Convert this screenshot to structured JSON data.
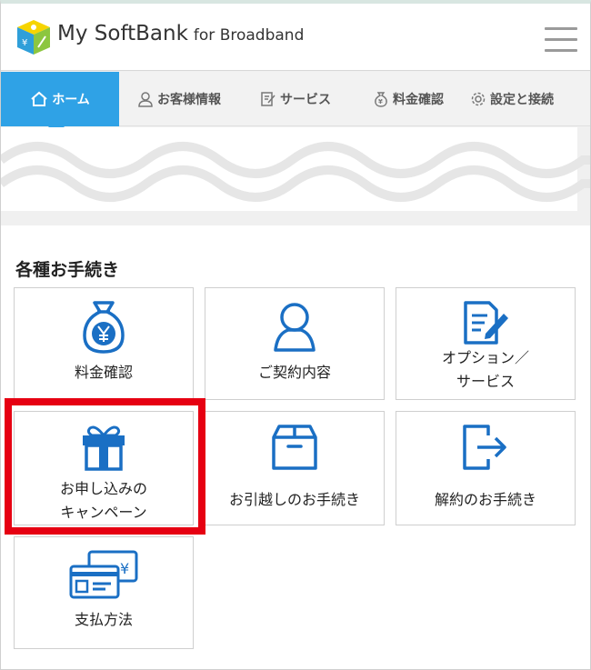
{
  "header": {
    "brand": "My SoftBank",
    "brand_suffix": "for Broadband",
    "menu_icon": "hamburger-icon"
  },
  "nav": {
    "tabs": [
      {
        "label": "ホーム",
        "icon": "home-icon",
        "active": true
      },
      {
        "label": "お客様情報",
        "icon": "user-icon",
        "active": false
      },
      {
        "label": "サービス",
        "icon": "edit-icon",
        "active": false
      },
      {
        "label": "料金確認",
        "icon": "money-bag-icon",
        "active": false
      },
      {
        "label": "設定と接続",
        "icon": "gear-icon",
        "active": false
      }
    ]
  },
  "procedures": {
    "title": "各種お手続き",
    "tiles": [
      {
        "line1": "料金確認",
        "line2": "",
        "icon": "yen-bag-icon"
      },
      {
        "line1": "ご契約内容",
        "line2": "",
        "icon": "person-icon"
      },
      {
        "line1": "オプション／",
        "line2": "サービス",
        "icon": "document-edit-icon"
      },
      {
        "line1": "お申し込みの",
        "line2": "キャンペーン",
        "icon": "gift-icon",
        "highlighted": true
      },
      {
        "line1": "お引越しのお手続き",
        "line2": "",
        "icon": "box-icon"
      },
      {
        "line1": "解約のお手続き",
        "line2": "",
        "icon": "exit-icon"
      },
      {
        "line1": "支払方法",
        "line2": "",
        "icon": "credit-card-icon"
      }
    ]
  },
  "colors": {
    "accent": "#2fa2e6",
    "icon_blue": "#1a6fc4",
    "highlight_red": "#e60012"
  }
}
